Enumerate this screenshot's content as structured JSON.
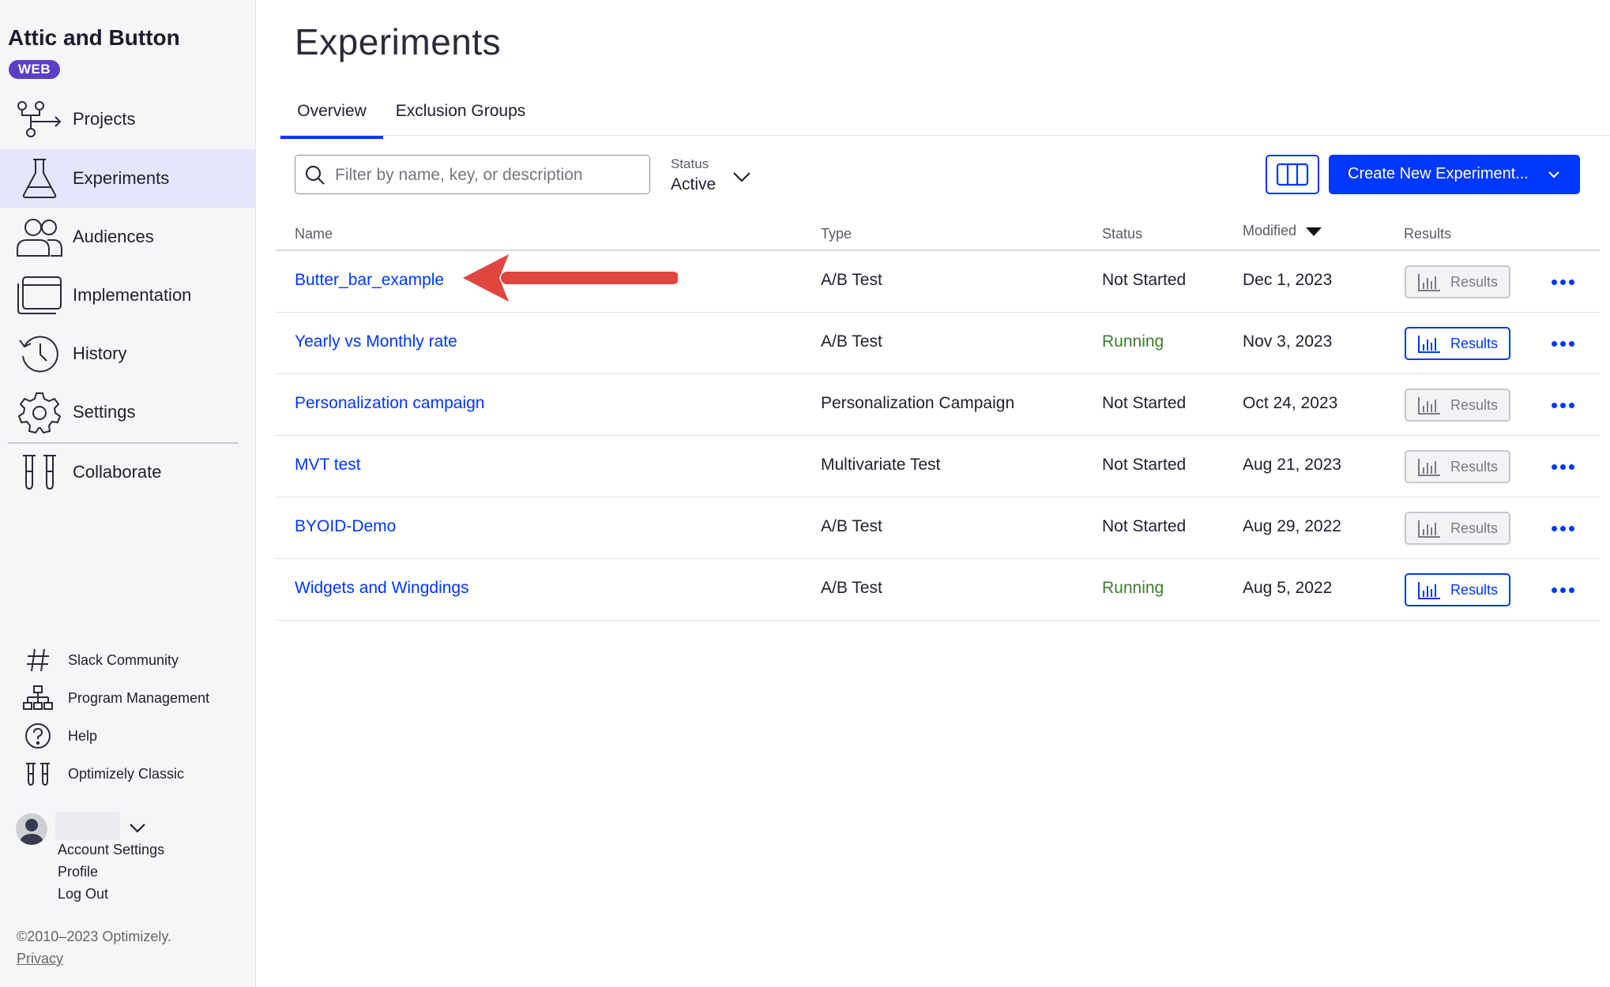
{
  "sidebar": {
    "brand": "Attic and Button",
    "badge": "WEB",
    "nav": [
      {
        "label": "Projects",
        "icon": "projects-icon"
      },
      {
        "label": "Experiments",
        "icon": "flask-icon"
      },
      {
        "label": "Audiences",
        "icon": "audiences-icon"
      },
      {
        "label": "Implementation",
        "icon": "implementation-icon"
      },
      {
        "label": "History",
        "icon": "history-icon"
      },
      {
        "label": "Settings",
        "icon": "gear-icon"
      },
      {
        "label": "Collaborate",
        "icon": "collaborate-icon"
      }
    ],
    "utility": [
      {
        "label": "Slack Community",
        "icon": "hash-icon"
      },
      {
        "label": "Program Management",
        "icon": "org-chart-icon"
      },
      {
        "label": "Help",
        "icon": "help-icon"
      },
      {
        "label": "Optimizely Classic",
        "icon": "classic-icon"
      }
    ],
    "account": {
      "links": [
        "Account Settings",
        "Profile",
        "Log Out"
      ]
    },
    "copyright": "©2010–2023 Optimizely.",
    "privacy": "Privacy"
  },
  "main": {
    "title": "Experiments",
    "tabs": [
      "Overview",
      "Exclusion Groups"
    ],
    "search": {
      "placeholder": "Filter by name, key, or description",
      "value": ""
    },
    "status_filter": {
      "label": "Status",
      "value": "Active"
    },
    "create_button": "Create New Experiment...",
    "table": {
      "headers": {
        "name": "Name",
        "type": "Type",
        "status": "Status",
        "modified": "Modified",
        "results": "Results"
      },
      "rows": [
        {
          "name": "Butter_bar_example",
          "type": "A/B Test",
          "status": "Not Started",
          "modified": "Dec 1, 2023",
          "results": "Results",
          "results_enabled": false
        },
        {
          "name": "Yearly vs Monthly rate",
          "type": "A/B Test",
          "status": "Running",
          "modified": "Nov 3, 2023",
          "results": "Results",
          "results_enabled": true
        },
        {
          "name": "Personalization campaign",
          "type": "Personalization Campaign",
          "status": "Not Started",
          "modified": "Oct 24, 2023",
          "results": "Results",
          "results_enabled": false
        },
        {
          "name": "MVT test",
          "type": "Multivariate Test",
          "status": "Not Started",
          "modified": "Aug 21, 2023",
          "results": "Results",
          "results_enabled": false
        },
        {
          "name": "BYOID-Demo",
          "type": "A/B Test",
          "status": "Not Started",
          "modified": "Aug 29, 2022",
          "results": "Results",
          "results_enabled": false
        },
        {
          "name": "Widgets and Wingdings",
          "type": "A/B Test",
          "status": "Running",
          "modified": "Aug 5, 2022",
          "results": "Results",
          "results_enabled": true
        }
      ]
    }
  },
  "colors": {
    "accent": "#0037ff",
    "running": "#3e7d2e",
    "badge": "#5b3fc4",
    "annotation_arrow": "#e0463e",
    "active_nav_bg": "#e5e6fb"
  }
}
